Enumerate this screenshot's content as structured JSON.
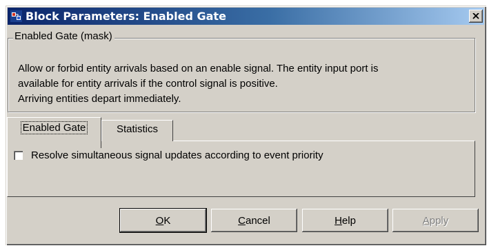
{
  "window": {
    "title": "Block Parameters: Enabled Gate"
  },
  "mask": {
    "group_label": "Enabled Gate (mask)",
    "description_lines": [
      "Allow or forbid entity arrivals based on an enable signal. The entity input port is",
      "available for entity arrivals if the control signal is positive.",
      "Arriving entities depart immediately."
    ]
  },
  "tabs": [
    {
      "label": "Enabled Gate",
      "active": true
    },
    {
      "label": "Statistics",
      "active": false
    }
  ],
  "options": {
    "resolve_checkbox_label": "Resolve simultaneous signal updates according to event priority",
    "resolve_checked": false
  },
  "buttons": {
    "ok": "OK",
    "cancel": "Cancel",
    "help": "Help",
    "apply": "Apply"
  },
  "colors": {
    "title_bar_start": "#0a246a",
    "title_bar_end": "#a6caf0",
    "face": "#d4d0c8"
  },
  "icons": {
    "app": "simulink-block-icon",
    "close": "close-icon"
  }
}
